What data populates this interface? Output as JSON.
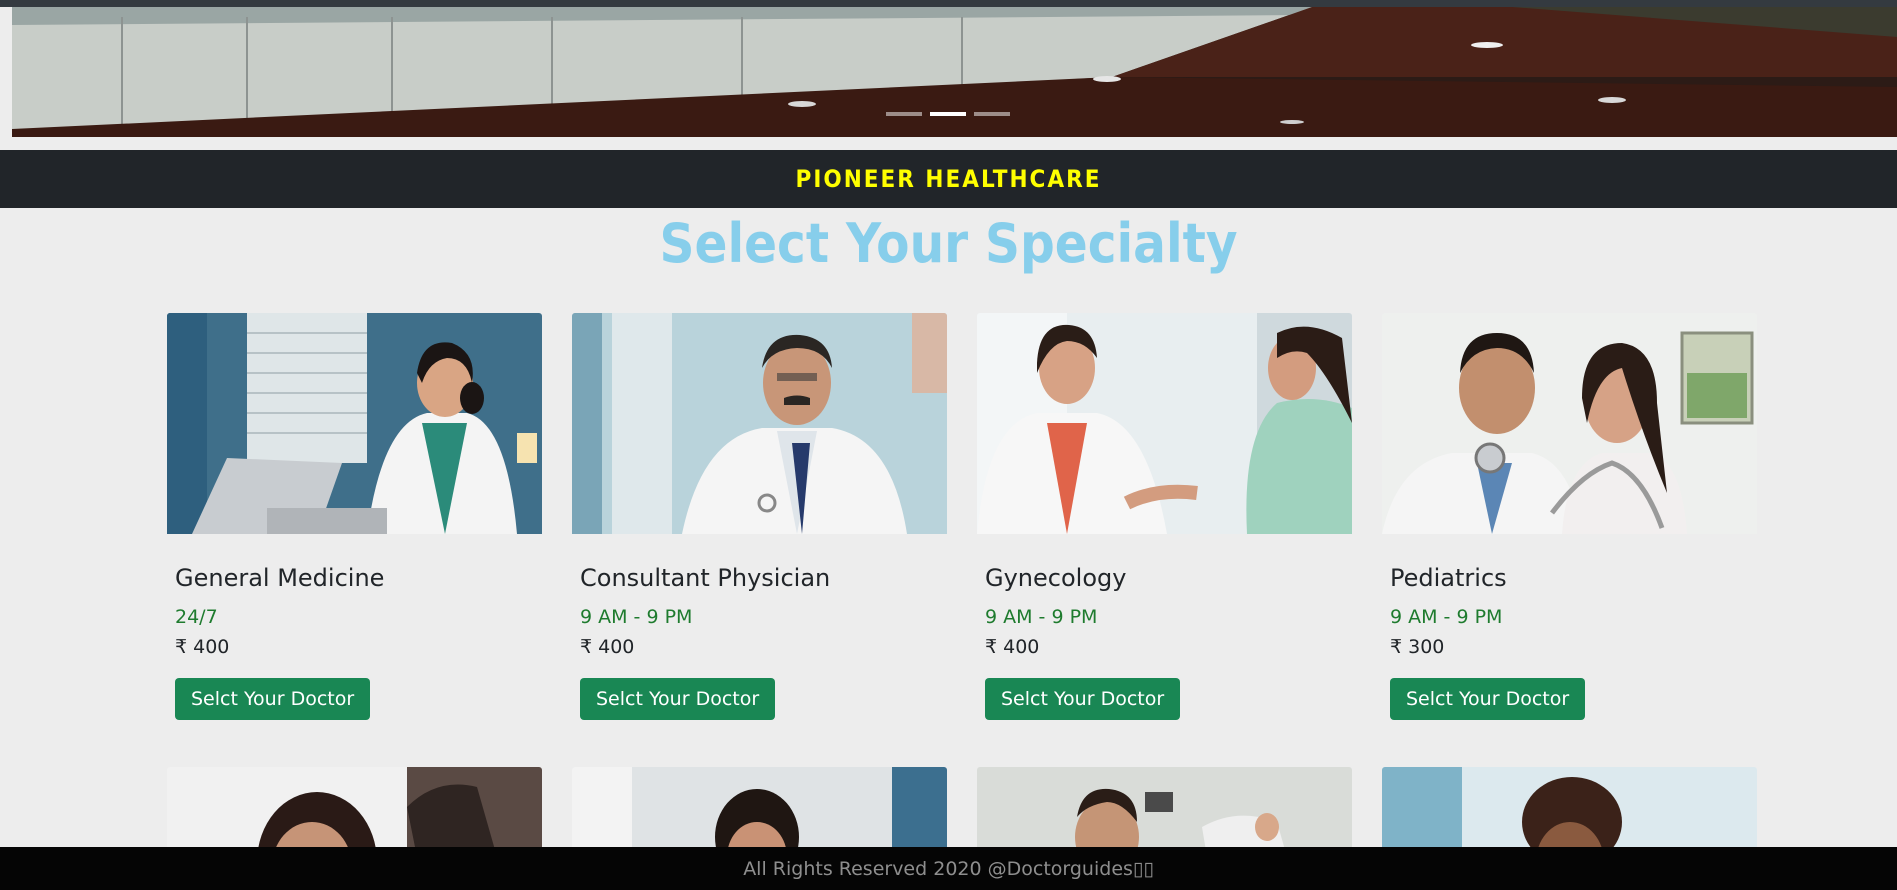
{
  "brand": {
    "title": "PIONEER HEALTHCARE"
  },
  "page": {
    "heading": "Select Your Specialty"
  },
  "carousel": {
    "active_index": 1,
    "slide_count": 3
  },
  "specialties": [
    {
      "title": "General Medicine",
      "hours": "24/7",
      "fee": "₹ 400",
      "button": "Selct Your Doctor"
    },
    {
      "title": "Consultant Physician",
      "hours": "9 AM - 9 PM",
      "fee": "₹ 400",
      "button": "Selct Your Doctor"
    },
    {
      "title": "Gynecology",
      "hours": "9 AM - 9 PM",
      "fee": "₹ 400",
      "button": "Selct Your Doctor"
    },
    {
      "title": "Pediatrics",
      "hours": "9 AM - 9 PM",
      "fee": "₹ 300",
      "button": "Selct Your Doctor"
    }
  ],
  "footer": {
    "text": "All Rights Reserved 2020 @Doctorguides▯▯"
  },
  "colors": {
    "brand_text": "#ffff00",
    "heading": "#87ceeb",
    "hours_text": "#1e7b2e",
    "button": "#198754",
    "navbar": "#212529"
  }
}
